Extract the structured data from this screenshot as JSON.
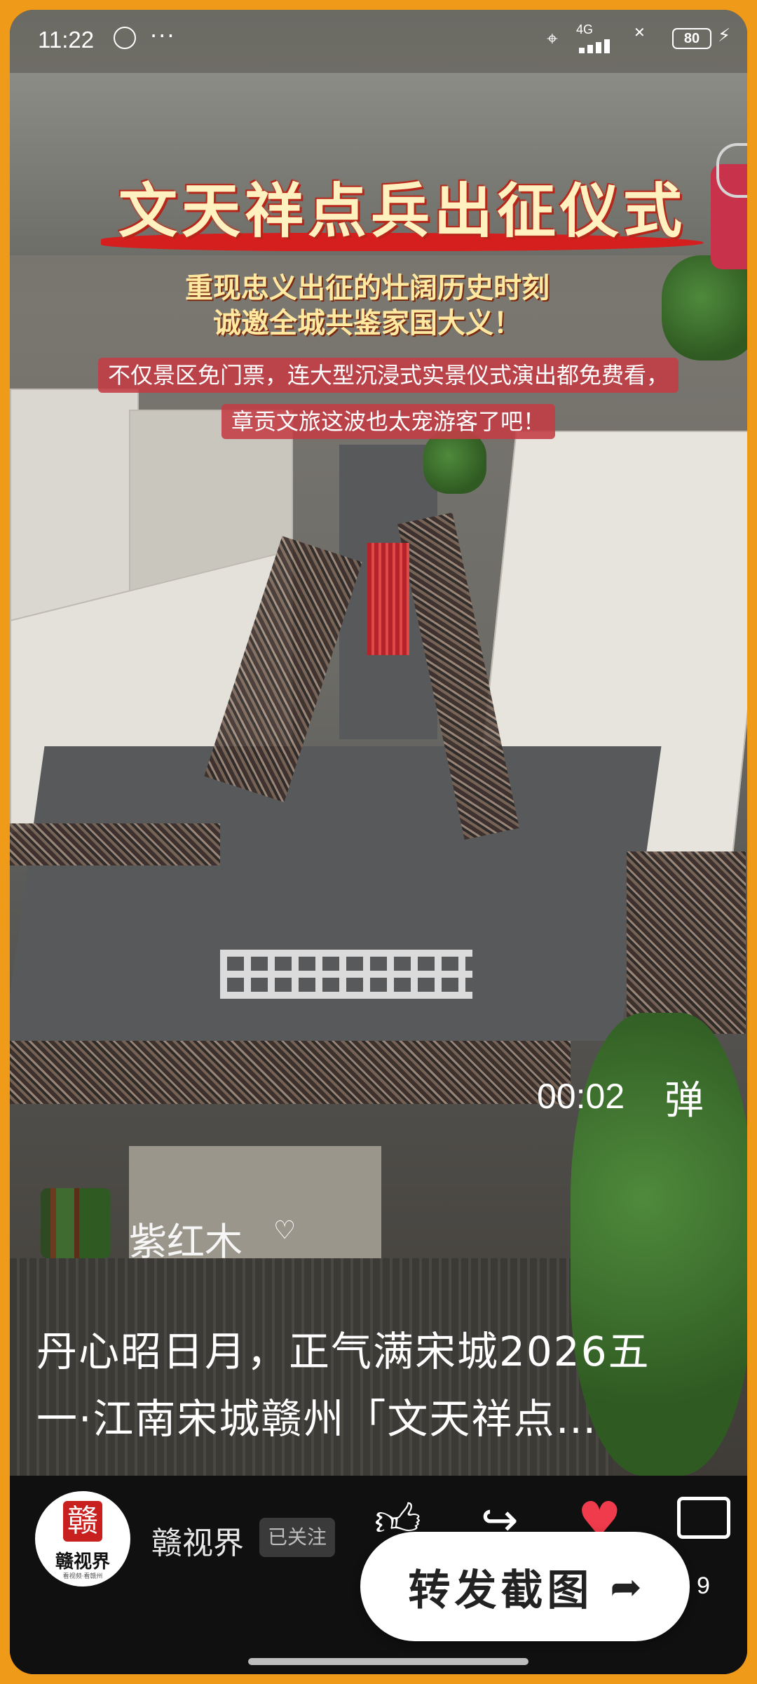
{
  "status_bar": {
    "time": "11:22",
    "dots": "···",
    "network": "4G",
    "battery": "80"
  },
  "video": {
    "title_banner": "文天祥点兵出征仪式",
    "subtitle_line1": "重现忠义出征的壮阔历史时刻",
    "subtitle_line2": "诚邀全城共鉴家国大义！",
    "notice_line1": "不仅景区免门票，连大型沉浸式实景仪式演出都免费看，",
    "notice_line2": "章贡文旅这波也太宠游客了吧！",
    "timecode": "00:02",
    "danmu_label": "弹",
    "music_name": "紫红木"
  },
  "caption": {
    "line1": "丹心昭日月，正气满宋城2026五",
    "line2": "一·江南宋城赣州「文天祥点…"
  },
  "footer": {
    "avatar_seal": "赣",
    "avatar_text": "赣视界",
    "avatar_tiny": "看视频·看赣州",
    "channel_name": "赣视界",
    "follow_label": "已关注",
    "comment_count": "9",
    "share_button_label": "转发截图"
  },
  "colors": {
    "frame": "#f09a1a",
    "accent_red": "#ef3b4b",
    "banner_red": "#d51f1f"
  },
  "icons": [
    "alarm-icon",
    "location-icon",
    "signal-icon",
    "battery-icon",
    "thumbs-up-icon",
    "share-icon",
    "heart-icon",
    "comment-icon",
    "arrow-right-icon"
  ]
}
